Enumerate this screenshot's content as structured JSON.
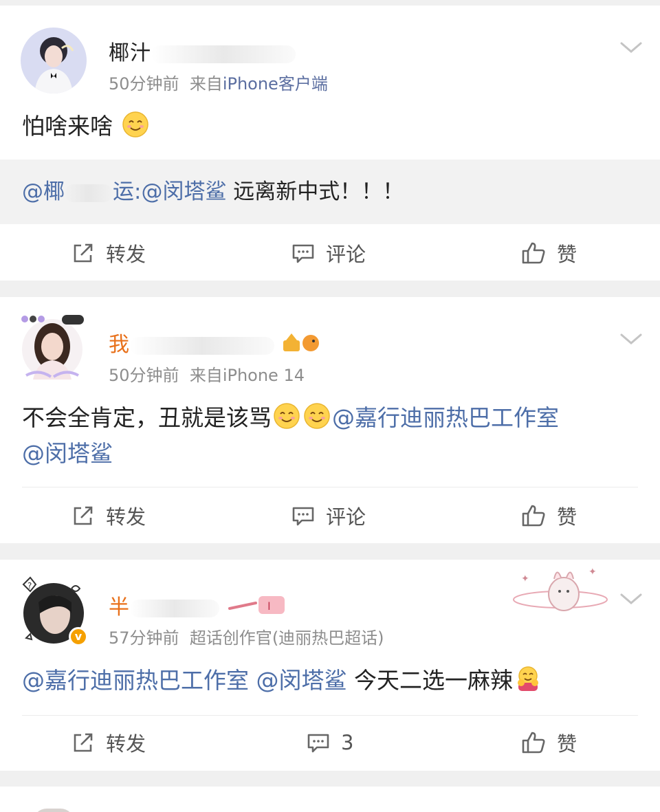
{
  "posts": [
    {
      "username": "椰汁",
      "username_color": "#222222",
      "time": "50分钟前",
      "source_prefix": "来自",
      "source": "iPhone客户端",
      "text": "怕啥来啥",
      "repost": {
        "author": "@椰",
        "author_tail": "运",
        "mention": ":@闵塔鲨",
        "text": " 远离新中式！！！"
      },
      "actions": {
        "repost": "转发",
        "comment": "评论",
        "like": "赞"
      }
    },
    {
      "username": "我",
      "username_color": "#e8701a",
      "time": "50分钟前",
      "source_prefix": "来自",
      "source": "iPhone 14",
      "text": "不会全肯定，丑就是该骂",
      "mention1": "@嘉行迪丽热巴工作室",
      "mention2": "@闵塔鲨",
      "actions": {
        "repost": "转发",
        "comment": "评论",
        "like": "赞"
      }
    },
    {
      "username": "半",
      "username_color": "#e8701a",
      "time": "57分钟前",
      "source_prefix": "超话创作官",
      "source": "(迪丽热巴超话)",
      "mention1": "@嘉行迪丽热巴工作室",
      "mention2": "@闵塔鲨",
      "text": " 今天二选一麻辣",
      "actions": {
        "repost": "转发",
        "comment": "3",
        "like": "赞"
      }
    }
  ],
  "icons": [
    "chevron-down-icon",
    "share-icon",
    "comment-icon",
    "like-icon",
    "smile-emoji",
    "hug-emoji",
    "verified-badge-icon"
  ],
  "colors": {
    "mention": "#4d6ea8",
    "meta": "#8d8d8d",
    "orange_name": "#e8701a",
    "background": "#f0f0f0"
  }
}
